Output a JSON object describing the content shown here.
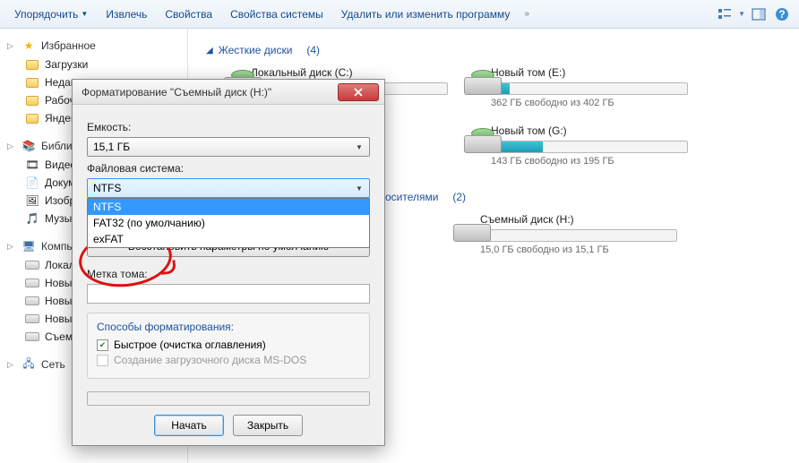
{
  "toolbar": {
    "organize": "Упорядочить",
    "extract": "Извлечь",
    "properties": "Свойства",
    "system_properties": "Свойства системы",
    "uninstall": "Удалить или изменить программу"
  },
  "sidebar": {
    "favorites": {
      "label": "Избранное"
    },
    "fav_items": [
      {
        "label": "Загрузки"
      },
      {
        "label": "Недав"
      },
      {
        "label": "Рабоч"
      },
      {
        "label": "Яндек"
      }
    ],
    "libraries": {
      "label": "Библио"
    },
    "lib_items": [
      {
        "label": "Видео"
      },
      {
        "label": "Докум"
      },
      {
        "label": "Изобр"
      },
      {
        "label": "Музы"
      }
    ],
    "computer": {
      "label": "Компь"
    },
    "comp_items": [
      {
        "label": "Локал"
      },
      {
        "label": "Новы"
      },
      {
        "label": "Новы"
      },
      {
        "label": "Новы"
      },
      {
        "label": "Съем"
      }
    ],
    "network": {
      "label": "Сеть"
    }
  },
  "sections": {
    "hdd": {
      "title": "Жесткие диски",
      "count": "(4)"
    },
    "removable": {
      "title": "осителями",
      "count": "(2)"
    }
  },
  "drives": [
    {
      "name": "Локальный диск (C:)",
      "fill": 0,
      "sub": ""
    },
    {
      "name": "Новый том (E:)",
      "fill": 9,
      "sub": "362 ГБ свободно из 402 ГБ"
    },
    {
      "name": "Новый том (G:)",
      "fill": 26,
      "sub": "143 ГБ свободно из 195 ГБ"
    }
  ],
  "removable_drive": {
    "name": "Съемный диск (H:)",
    "fill": 1,
    "sub": "15,0 ГБ свободно из 15,1 ГБ"
  },
  "dialog": {
    "title": "Форматирование \"Съемный диск (H:)\"",
    "capacity_label": "Емкость:",
    "capacity_value": "15,1 ГБ",
    "fs_label": "Файловая система:",
    "fs_value": "NTFS",
    "fs_options": [
      "NTFS",
      "FAT32 (по умолчанию)",
      "exFAT"
    ],
    "restore_defaults": "Восстановить параметры по умолчанию",
    "volume_label": "Метка тома:",
    "volume_value": "",
    "methods_label": "Способы форматирования:",
    "quick_format": "Быстрое (очистка оглавления)",
    "msdos_boot": "Создание загрузочного диска MS-DOS",
    "start": "Начать",
    "close": "Закрыть"
  }
}
